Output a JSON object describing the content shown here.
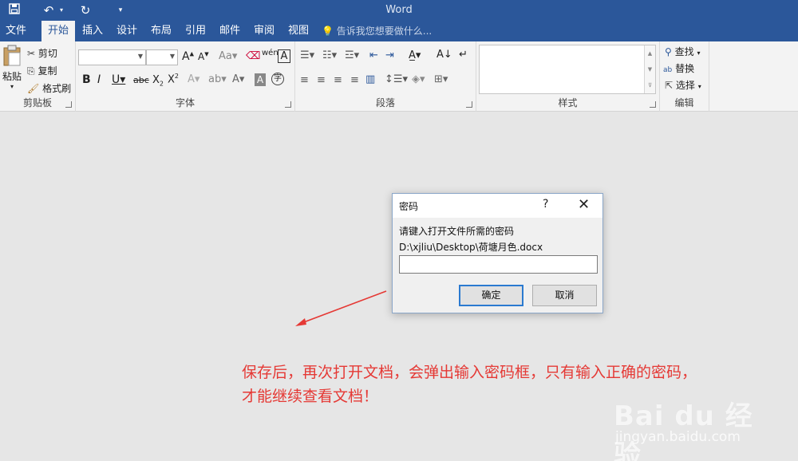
{
  "app": {
    "title": "Word",
    "qat": {
      "save_icon": "save-icon",
      "undo_icon": "undo-icon",
      "redo_icon": "redo-icon",
      "customize_icon": "customize-qat-icon"
    }
  },
  "tabs": [
    {
      "label": "文件"
    },
    {
      "label": "开始"
    },
    {
      "label": "插入"
    },
    {
      "label": "设计"
    },
    {
      "label": "布局"
    },
    {
      "label": "引用"
    },
    {
      "label": "邮件"
    },
    {
      "label": "审阅"
    },
    {
      "label": "视图"
    }
  ],
  "tell_me": "告诉我您想要做什么...",
  "ribbon": {
    "clipboard": {
      "paste": "粘贴",
      "cut": "剪切",
      "copy": "复制",
      "format_painter": "格式刷",
      "label": "剪贴板"
    },
    "font": {
      "label": "字体",
      "font_name": "",
      "font_size": ""
    },
    "paragraph": {
      "label": "段落"
    },
    "styles": {
      "label": "样式"
    },
    "editing": {
      "find": "查找",
      "replace": "替换",
      "select": "选择",
      "label": "编辑"
    }
  },
  "dialog": {
    "title": "密码",
    "help": "?",
    "close": "✕",
    "prompt": "请键入打开文件所需的密码",
    "path": "D:\\xjliu\\Desktop\\荷塘月色.docx",
    "password_value": "",
    "ok": "确定",
    "cancel": "取消"
  },
  "annotation": {
    "line1": "保存后，再次打开文档，会弹出输入密码框，只有输入正确的密码，",
    "line2": "才能继续查看文档！",
    "color": "#e53935"
  },
  "watermark": {
    "logo": "Bai du 经验",
    "url": "jingyan.baidu.com"
  },
  "colors": {
    "word_blue": "#2b579a",
    "background": "#e6e6e6"
  }
}
